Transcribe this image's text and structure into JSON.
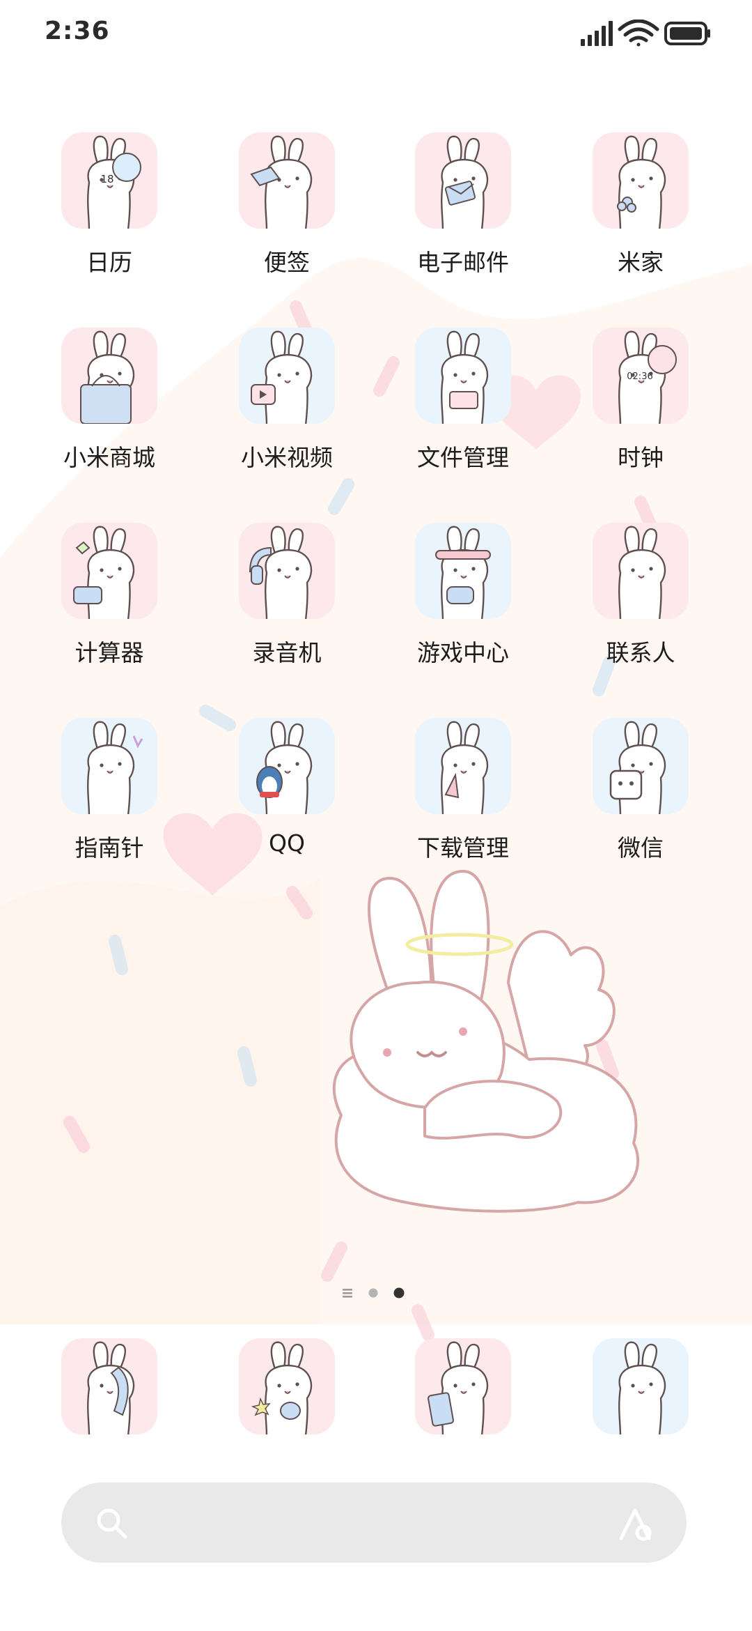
{
  "status_bar": {
    "time": "2:36",
    "icons": [
      "signal-icon",
      "wifi-icon",
      "battery-icon"
    ]
  },
  "apps": [
    {
      "label": "日历",
      "icon": "calendar-icon",
      "bg": "#fde8ec",
      "detail": "18"
    },
    {
      "label": "便签",
      "icon": "notes-icon",
      "bg": "#fde8ec",
      "detail": ""
    },
    {
      "label": "电子邮件",
      "icon": "email-icon",
      "bg": "#fde8ec",
      "detail": ""
    },
    {
      "label": "米家",
      "icon": "mijia-icon",
      "bg": "#fde8ec",
      "detail": ""
    },
    {
      "label": "小米商城",
      "icon": "mi-store-icon",
      "bg": "#fde8ec",
      "detail": ""
    },
    {
      "label": "小米视频",
      "icon": "mi-video-icon",
      "bg": "#eaf4fc",
      "detail": ""
    },
    {
      "label": "文件管理",
      "icon": "file-manager-icon",
      "bg": "#eaf4fc",
      "detail": ""
    },
    {
      "label": "时钟",
      "icon": "clock-icon",
      "bg": "#fde8ec",
      "detail": "02:36"
    },
    {
      "label": "计算器",
      "icon": "calculator-icon",
      "bg": "#fde8ec",
      "detail": ""
    },
    {
      "label": "录音机",
      "icon": "recorder-icon",
      "bg": "#fde8ec",
      "detail": ""
    },
    {
      "label": "游戏中心",
      "icon": "game-center-icon",
      "bg": "#eaf4fc",
      "detail": ""
    },
    {
      "label": "联系人",
      "icon": "contacts-icon",
      "bg": "#fde8ec",
      "detail": ""
    },
    {
      "label": "指南针",
      "icon": "compass-icon",
      "bg": "#eaf4fc",
      "detail": ""
    },
    {
      "label": "QQ",
      "icon": "qq-icon",
      "bg": "#eaf4fc",
      "detail": ""
    },
    {
      "label": "下载管理",
      "icon": "download-manager-icon",
      "bg": "#eaf4fc",
      "detail": ""
    },
    {
      "label": "微信",
      "icon": "wechat-icon",
      "bg": "#eaf4fc",
      "detail": ""
    }
  ],
  "page_indicator": {
    "pages": 3,
    "current": 3
  },
  "dock": [
    {
      "icon": "phone-icon",
      "bg": "#fde8ec"
    },
    {
      "icon": "messages-icon",
      "bg": "#fde8ec"
    },
    {
      "icon": "browser-icon",
      "bg": "#fde8ec"
    },
    {
      "icon": "camera-icon",
      "bg": "#eaf4fc"
    }
  ],
  "search_bar": {
    "placeholder": "",
    "left_icon": "search-icon",
    "right_icon": "assistant-icon"
  },
  "colors": {
    "pink_tile": "#fde8ec",
    "blue_tile": "#eaf4fc",
    "bunny_outline": "#6a5a5a",
    "search_bg": "#e9e9e9"
  }
}
